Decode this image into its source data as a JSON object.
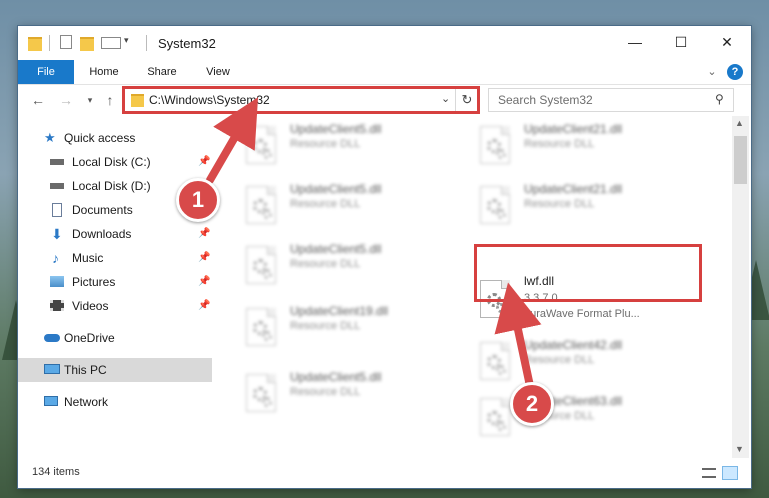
{
  "window": {
    "title": "System32",
    "minimize_glyph": "—",
    "maximize_glyph": "☐",
    "close_glyph": "✕"
  },
  "ribbon": {
    "tabs": [
      {
        "label": "File"
      },
      {
        "label": "Home"
      },
      {
        "label": "Share"
      },
      {
        "label": "View"
      }
    ],
    "help_glyph": "?",
    "expand_glyph": "⌄"
  },
  "address": {
    "path": "C:\\Windows\\System32",
    "search_placeholder": "Search System32"
  },
  "nav": {
    "items": [
      {
        "label": "Quick access"
      },
      {
        "label": "Local Disk (C:)"
      },
      {
        "label": "Local Disk (D:)"
      },
      {
        "label": "Documents"
      },
      {
        "label": "Downloads"
      },
      {
        "label": "Music"
      },
      {
        "label": "Pictures"
      },
      {
        "label": "Videos"
      },
      {
        "label": "OneDrive"
      },
      {
        "label": "This PC"
      },
      {
        "label": "Network"
      }
    ]
  },
  "files": [
    {
      "name": "UpdateClient5.dll",
      "desc": "Resource DLL"
    },
    {
      "name": "UpdateClient21.dll",
      "desc": "Resource DLL"
    },
    {
      "name": "UpdateClient5.dll",
      "desc": "Resource DLL"
    },
    {
      "name": "UpdateClient21.dll",
      "desc": "Resource DLL"
    },
    {
      "name": "UpdateClient5.dll",
      "desc": "Resource DLL"
    },
    {
      "name": "lwf.dll",
      "version": "3.3.7.0",
      "desc": "LuraWave Format Plu..."
    },
    {
      "name": "UpdateClient19.dll",
      "desc": "Resource DLL"
    },
    {
      "name": "UpdateClient42.dll",
      "desc": "Resource DLL"
    },
    {
      "name": "UpdateClient5.dll",
      "desc": "Resource DLL"
    },
    {
      "name": "UpdateClient63.dll",
      "desc": "Resource DLL"
    }
  ],
  "status": {
    "item_count": "134 items"
  },
  "annotations": {
    "step1": "1",
    "step2": "2"
  },
  "colors": {
    "accent": "#1979ca",
    "highlight": "#d6403f",
    "badge": "#d84a4a"
  }
}
